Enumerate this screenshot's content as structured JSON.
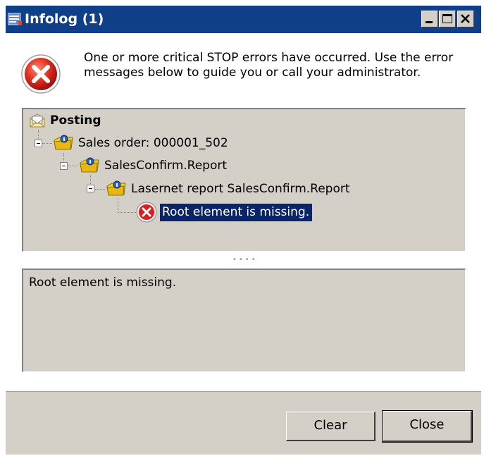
{
  "window": {
    "title": "Infolog (1)",
    "controls": {
      "minimize_icon": "minimize-icon",
      "maximize_icon": "maximize-icon",
      "close_icon": "close-icon"
    }
  },
  "message": {
    "icon": "error-icon",
    "text": "One or more critical STOP errors have occurred. Use the error messages below to guide you or call your administrator."
  },
  "tree": {
    "root": {
      "icon": "envelope-icon",
      "label": "Posting"
    },
    "items": [
      {
        "icon": "info-folder-icon",
        "label": "Sales order: 000001_502"
      },
      {
        "icon": "info-folder-icon",
        "label": "SalesConfirm.Report"
      },
      {
        "icon": "info-folder-icon",
        "label": "Lasernet report SalesConfirm.Report"
      },
      {
        "icon": "error-icon",
        "label": "Root element is missing.",
        "selected": true
      }
    ]
  },
  "detail": {
    "text": "Root element is missing."
  },
  "buttons": {
    "clear": "Clear",
    "close": "Close"
  },
  "colors": {
    "titlebar": "#0f3f86",
    "panel": "#d4d0c8",
    "selection": "#0a246a",
    "error_red": "#d42020"
  }
}
